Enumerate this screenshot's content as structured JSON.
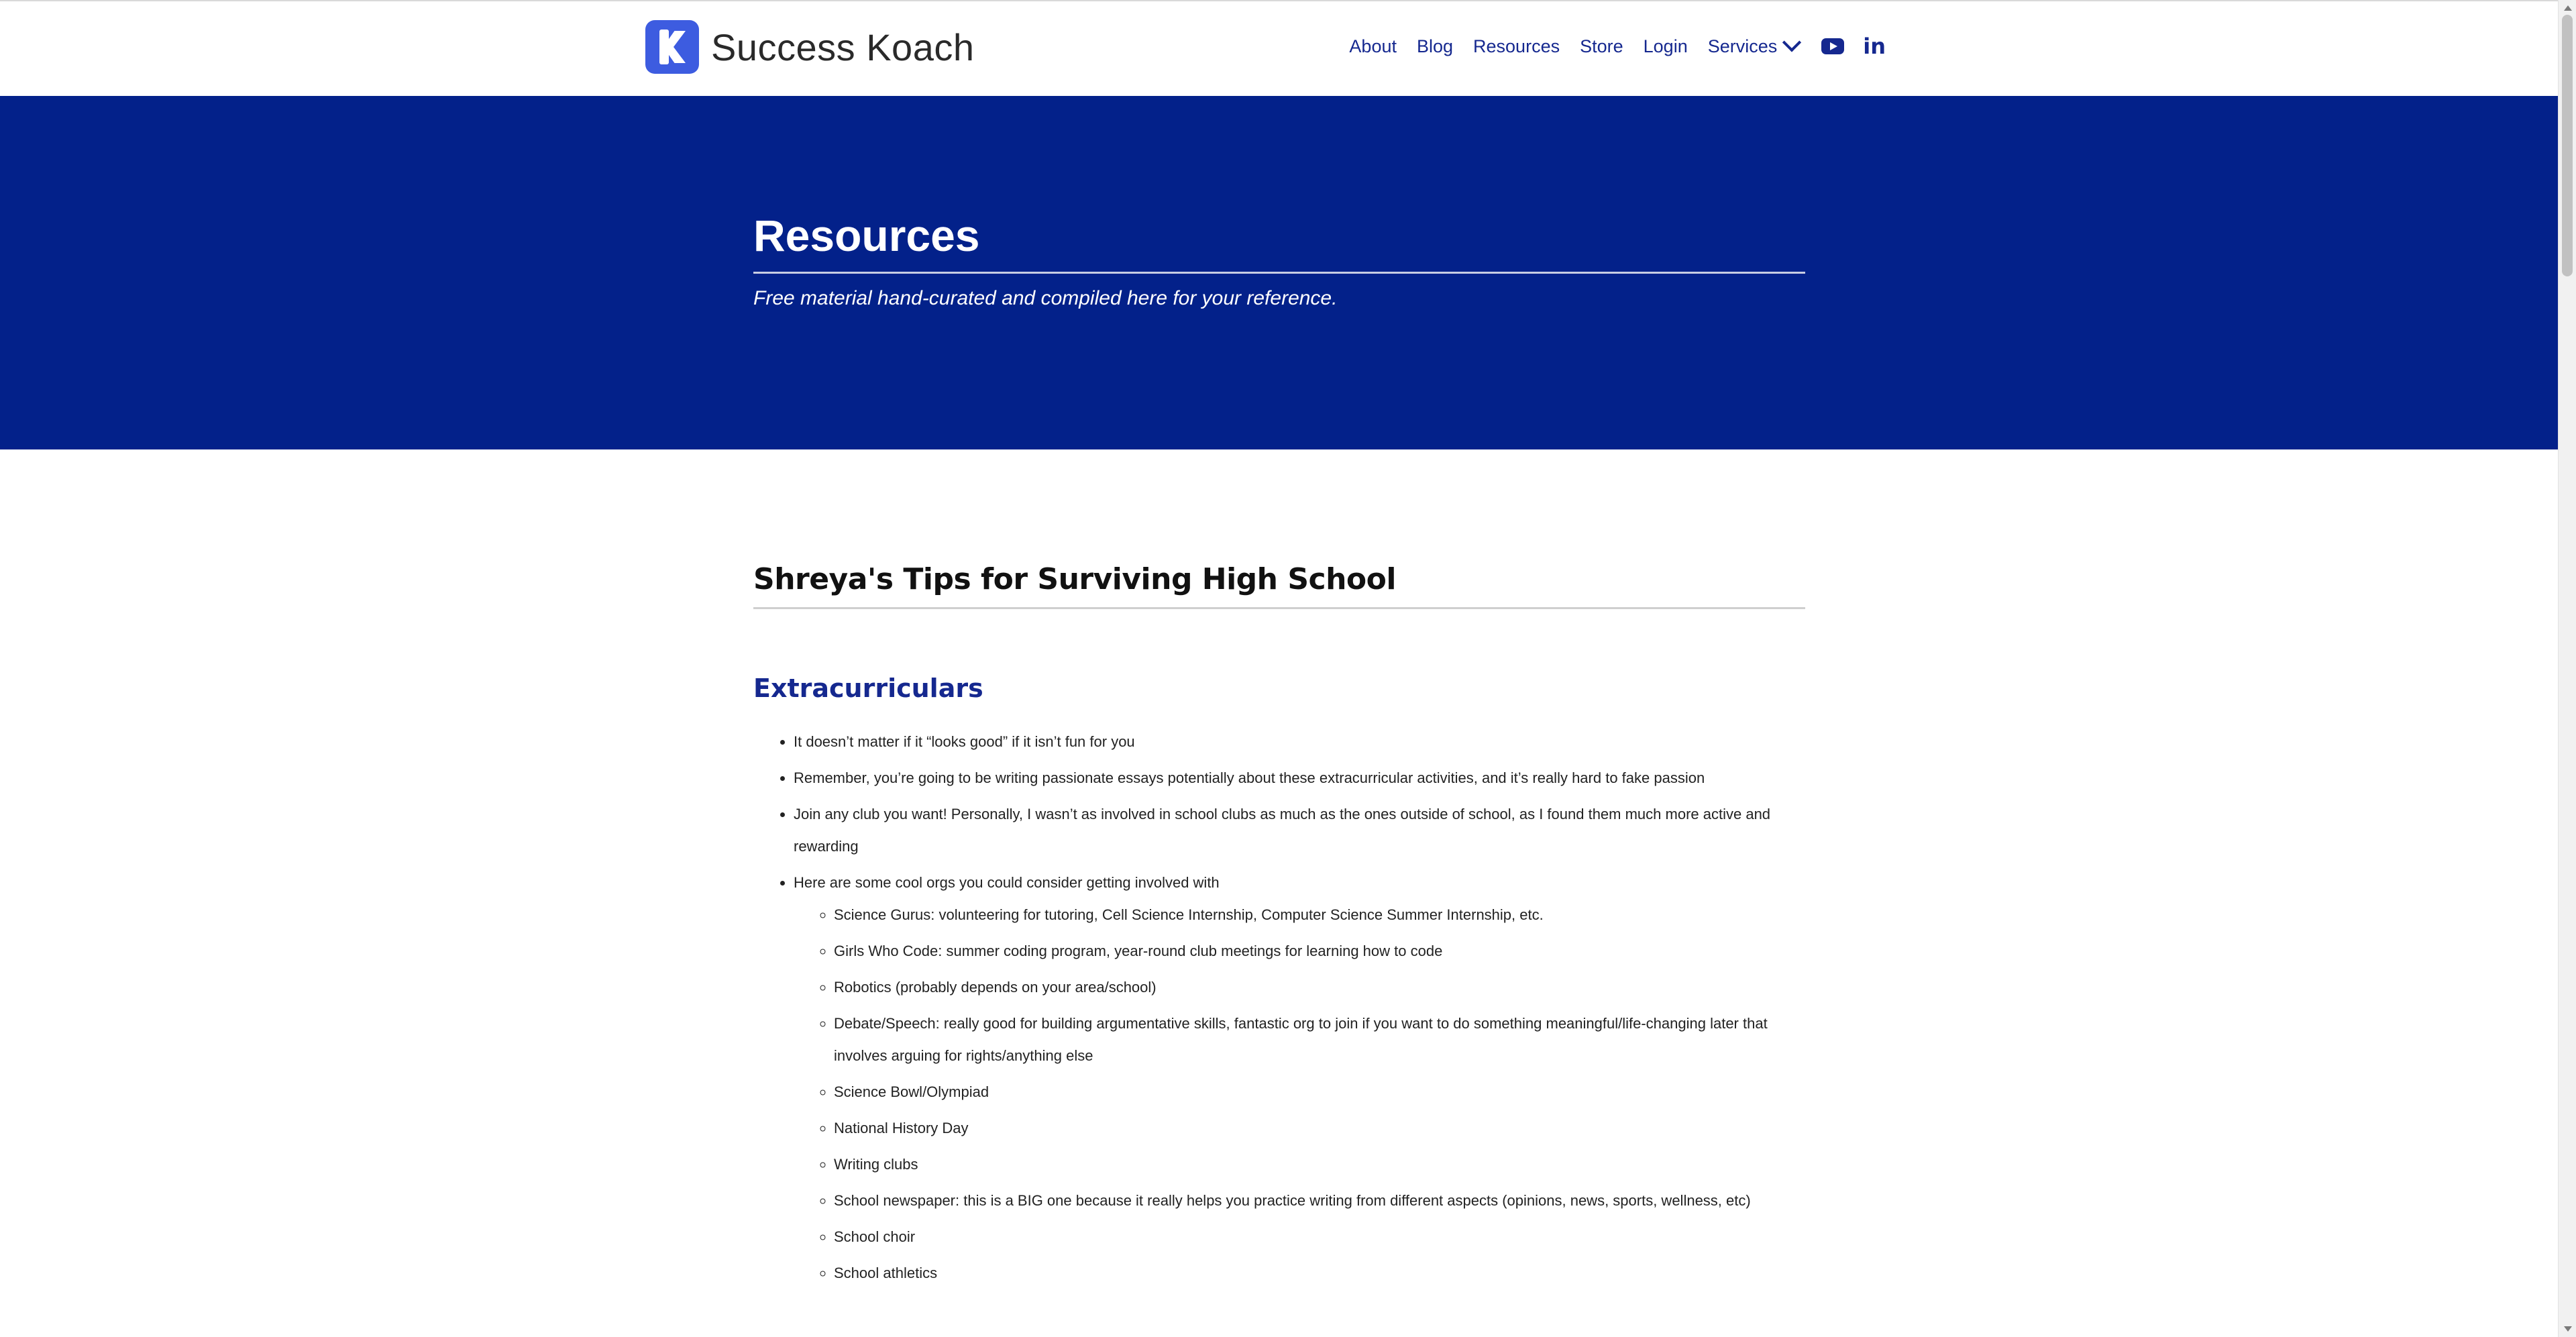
{
  "header": {
    "brand": "Success Koach",
    "nav": {
      "about": "About",
      "blog": "Blog",
      "resources": "Resources",
      "store": "Store",
      "login": "Login",
      "services": "Services"
    },
    "icons": {
      "youtube": "youtube-icon",
      "linkedin": "linkedin-icon",
      "linkedin_glyph": "in"
    }
  },
  "hero": {
    "title": "Resources",
    "subtitle": "Free material hand-curated and compiled here for your reference.",
    "background": "#03218a"
  },
  "main": {
    "section_title": "Shreya's Tips for Surviving High School",
    "subheading": "Extracurriculars",
    "bullets": [
      "It doesn’t matter if it “looks good” if it isn’t fun for you",
      "Remember, you’re going to be writing passionate essays potentially about these extracurricular activities, and it’s really hard to fake passion",
      "Join any club you want! Personally, I wasn’t as involved in school clubs as much as the ones outside of school, as I found them much more active and rewarding",
      "Here are some cool orgs you could consider getting involved with"
    ],
    "orgs": [
      "Science Gurus: volunteering for tutoring, Cell Science Internship, Computer Science Summer Internship, etc.",
      "Girls Who Code: summer coding program, year-round club meetings for learning how to code",
      "Robotics (probably depends on your area/school)",
      "Debate/Speech: really good for building argumentative skills, fantastic org to join if you want to do something meaningful/life-changing later that involves arguing for rights/anything else",
      "Science Bowl/Olympiad",
      "National History Day",
      "Writing clubs",
      "School newspaper: this is a BIG one because it really helps you practice writing from different aspects (opinions, news, sports, wellness, etc)",
      "School choir",
      "School athletics"
    ]
  },
  "colors": {
    "accent": "#15288f",
    "logo": "#3d5ce0"
  }
}
